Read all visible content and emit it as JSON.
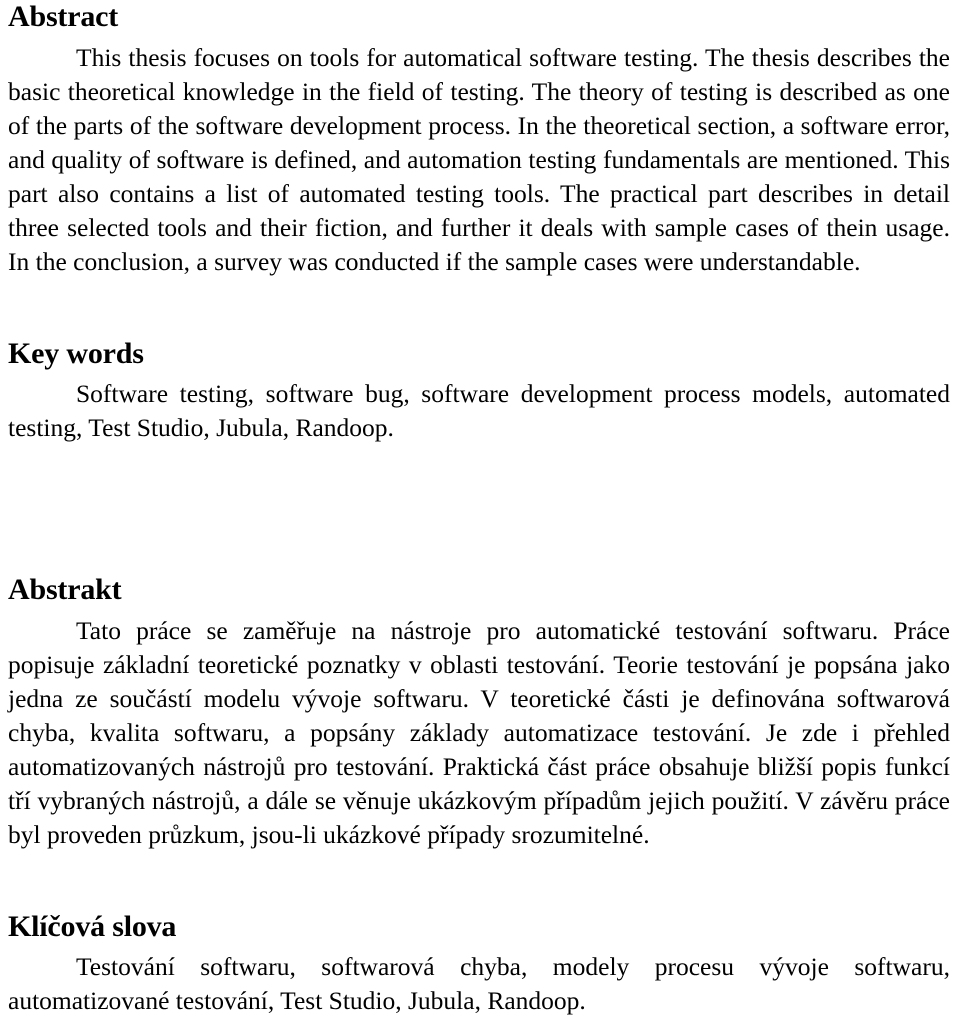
{
  "document": {
    "page_background": "#ffffff",
    "text_color": "#000000",
    "sections": [
      {
        "id": "abstract",
        "heading": "Abstract",
        "body": "This thesis focuses on tools for automatical software testing. The thesis describes the basic theoretical knowledge in the field of testing. The theory of testing is described as one of the parts of the software development process. In the theoretical section, a software error, and quality of software is defined, and automation testing fundamentals are mentioned. This part also contains a list of automated testing tools. The practical part describes in detail three selected tools and their fiction, and further it deals with sample cases of thein usage. In the conclusion, a survey was conducted if the sample cases were understandable."
      },
      {
        "id": "key-words",
        "heading": "Key words",
        "body": "Software testing, software bug, software development process models, automated testing, Test Studio, Jubula, Randoop."
      },
      {
        "id": "abstrakt",
        "heading": "Abstrakt",
        "body": "Tato práce se zaměřuje na nástroje pro automatické testování softwaru. Práce popisuje základní teoretické poznatky v oblasti testování. Teorie testování je popsána jako jedna ze součástí modelu vývoje softwaru. V teoretické části je definována softwarová chyba, kvalita softwaru, a popsány základy automatizace testování. Je zde i přehled automatizovaných nástrojů pro testování. Praktická část práce obsahuje bližší popis funkcí tří vybraných nástrojů, a dále se věnuje ukázkovým případům jejich použití. V závěru práce byl proveden průzkum, jsou-li ukázkové případy srozumitelné."
      },
      {
        "id": "klicova-slova",
        "heading": "Klíčová slova",
        "body": "Testování softwaru, softwarová chyba, modely procesu vývoje softwaru, automatizované testování, Test Studio, Jubula, Randoop."
      }
    ]
  }
}
